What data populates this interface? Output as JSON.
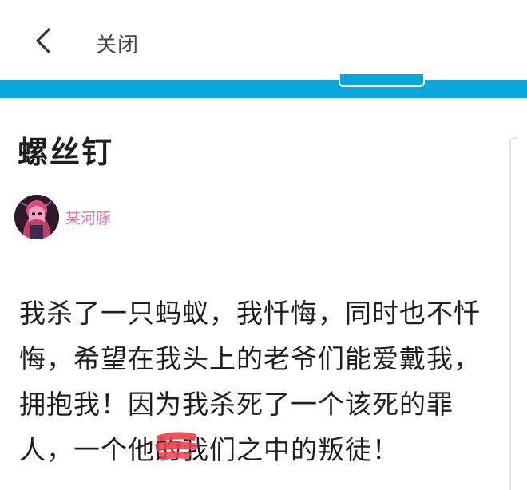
{
  "header": {
    "back_icon": "chevron-left-icon",
    "close_label": "关闭",
    "accent_color": "#0aa3da"
  },
  "post": {
    "title": "螺丝钉",
    "author": {
      "name": "某河豚",
      "name_color": "#e6779a"
    },
    "content": "我杀了一只蚂蚁，我忏悔，同时也不忏悔，希望在我头上的老爷们能爱戴我，拥抱我！因为我杀死了一个该死的罪人，一个他的我们之中的叛徒！"
  }
}
